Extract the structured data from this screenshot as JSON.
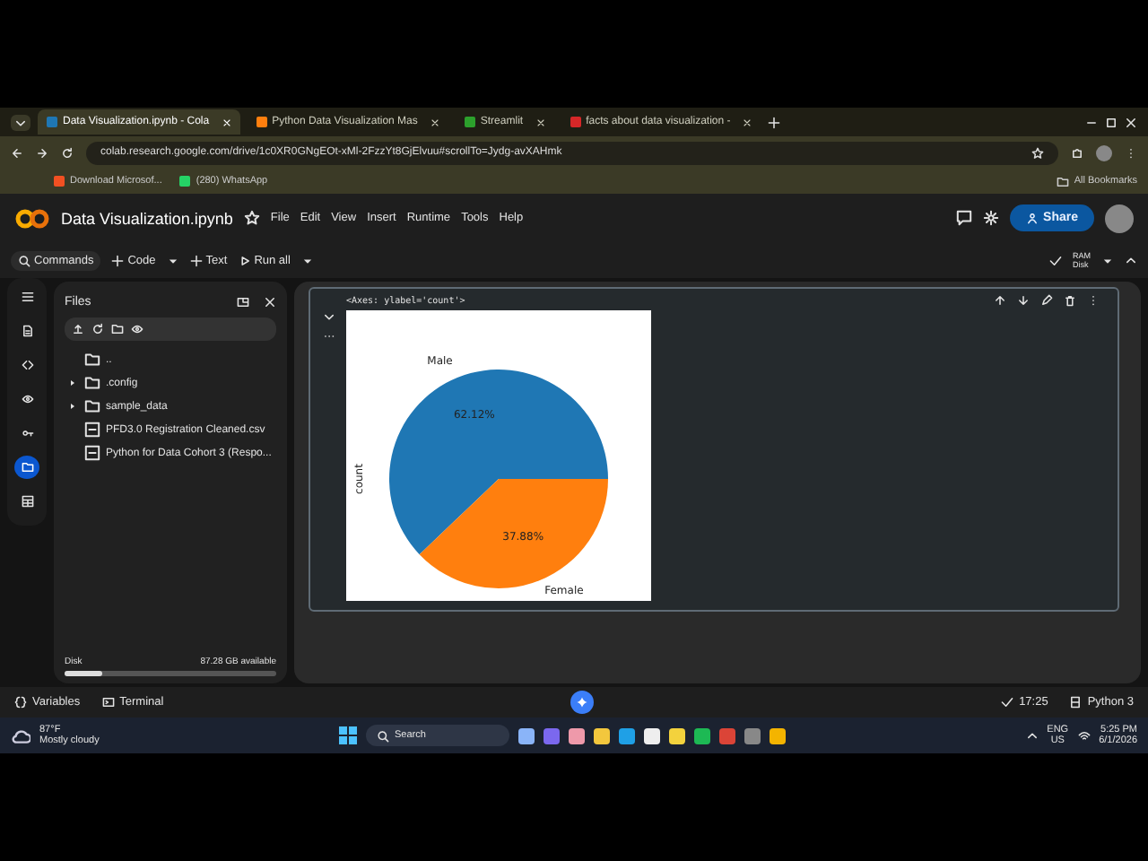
{
  "browser": {
    "tabs": [
      {
        "title": "Data Visualization.ipynb - Cola",
        "selected": true
      },
      {
        "title": "Python Data Visualization Mas",
        "selected": false
      },
      {
        "title": "Streamlit",
        "selected": false
      },
      {
        "title": "facts about data visualization -",
        "selected": false
      }
    ],
    "address": "colab.research.google.com/drive/1c0XR0GNgEOt-xMl-2FzzYt8GjElvuu#scrollTo=Jydg-avXAHmk",
    "bookmarks": [
      "Download Microsof...",
      "(280) WhatsApp"
    ],
    "all_bookmarks": "All Bookmarks"
  },
  "colab": {
    "title": "Data Visualization.ipynb",
    "menu": [
      "File",
      "Edit",
      "View",
      "Insert",
      "Runtime",
      "Tools",
      "Help"
    ],
    "share": "Share",
    "toolbar": [
      "Commands",
      "Code",
      "Text",
      "Run all"
    ],
    "ram": "RAM",
    "disk": "Disk"
  },
  "sidebar": {
    "items": [
      {
        "selected": false
      },
      {
        "selected": false
      },
      {
        "selected": false
      },
      {
        "selected": false
      },
      {
        "selected": false
      },
      {
        "selected": true
      },
      {
        "selected": false
      }
    ]
  },
  "files": {
    "title": "Files",
    "tree": [
      {
        "name": "..",
        "kind": "parent"
      },
      {
        "name": ".config",
        "kind": "folder"
      },
      {
        "name": "sample_data",
        "kind": "folder"
      },
      {
        "name": "PFD3.0 Registration Cleaned.csv",
        "kind": "file"
      },
      {
        "name": "Python for Data Cohort 3 (Respo...",
        "kind": "file"
      }
    ],
    "disk_label": "Disk",
    "disk_free": "87.28 GB available",
    "level": 0.18
  },
  "cell": {
    "output_text": "<Axes: ylabel='count'>",
    "chart_data": {
      "type": "pie",
      "ylabel": "count",
      "categories": [
        "Male",
        "Female"
      ],
      "values": [
        62.12,
        37.88
      ],
      "value_labels": [
        "62.12%",
        "37.88%"
      ]
    }
  },
  "status_bar": {
    "variables": "Variables",
    "terminal": "Terminal",
    "time": "17:25",
    "runtime": "Python 3"
  },
  "taskbar": {
    "temperature": "87°F",
    "weather": "Mostly cloudy",
    "search": "Search",
    "lang": "ENG",
    "region": "US",
    "time": "5:25 PM",
    "date": "6/1/2026"
  }
}
